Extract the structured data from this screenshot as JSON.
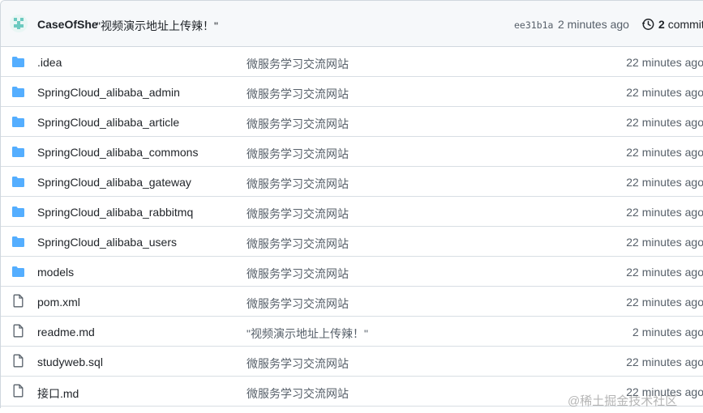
{
  "header": {
    "author": "CaseOfShe",
    "message": "\"视频演示地址上传辣！\"",
    "sha": "ee31b1a",
    "time": "2 minutes ago",
    "commits_count": "2",
    "commits_label": "commits"
  },
  "files": [
    {
      "type": "folder",
      "name": ".idea",
      "message": "微服务学习交流网站",
      "time": "22 minutes ago"
    },
    {
      "type": "folder",
      "name": "SpringCloud_alibaba_admin",
      "message": "微服务学习交流网站",
      "time": "22 minutes ago"
    },
    {
      "type": "folder",
      "name": "SpringCloud_alibaba_article",
      "message": "微服务学习交流网站",
      "time": "22 minutes ago"
    },
    {
      "type": "folder",
      "name": "SpringCloud_alibaba_commons",
      "message": "微服务学习交流网站",
      "time": "22 minutes ago"
    },
    {
      "type": "folder",
      "name": "SpringCloud_alibaba_gateway",
      "message": "微服务学习交流网站",
      "time": "22 minutes ago"
    },
    {
      "type": "folder",
      "name": "SpringCloud_alibaba_rabbitmq",
      "message": "微服务学习交流网站",
      "time": "22 minutes ago"
    },
    {
      "type": "folder",
      "name": "SpringCloud_alibaba_users",
      "message": "微服务学习交流网站",
      "time": "22 minutes ago"
    },
    {
      "type": "folder",
      "name": "models",
      "message": "微服务学习交流网站",
      "time": "22 minutes ago"
    },
    {
      "type": "file",
      "name": "pom.xml",
      "message": "微服务学习交流网站",
      "time": "22 minutes ago"
    },
    {
      "type": "file",
      "name": "readme.md",
      "message": "\"视频演示地址上传辣！\"",
      "time": "2 minutes ago"
    },
    {
      "type": "file",
      "name": "studyweb.sql",
      "message": "微服务学习交流网站",
      "time": "22 minutes ago"
    },
    {
      "type": "file",
      "name": "接口.md",
      "message": "微服务学习交流网站",
      "time": "22 minutes ago"
    }
  ],
  "watermark": "@稀土掘金技术社区",
  "colors": {
    "folder": "#54aeff",
    "file": "#57606a",
    "border": "#d0d7de",
    "header_bg": "#f6f8fa"
  }
}
